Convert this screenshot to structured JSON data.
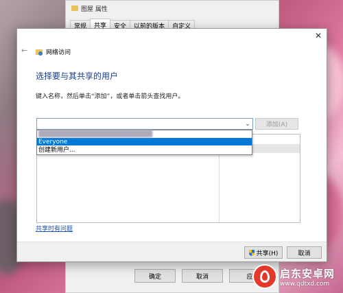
{
  "props_window": {
    "title": "图屋 属性",
    "tabs": [
      "常规",
      "共享",
      "安全",
      "以前的版本",
      "自定义"
    ],
    "buttons": {
      "ok": "确定",
      "cancel": "取消",
      "apply": "应"
    }
  },
  "dialog": {
    "header": "网络访问",
    "heading": "选择要与其共享的用户",
    "instruction": "键入名称，然后单击“添加”，或者单击箭头查找用户。",
    "add_button": "添加(A)",
    "dropdown_items": [
      "Everyone",
      "创建新用户..."
    ],
    "help_link": "共享时有问题",
    "share_button": "共享(H)",
    "cancel_button": "取消"
  },
  "icons": {
    "close": "close-icon",
    "back": "back-arrow-icon",
    "dropdown": "chevron-down-icon",
    "shield": "uac-shield-icon",
    "network": "network-share-icon"
  },
  "watermark": {
    "title": "启东安卓网",
    "url": "www.qdtxd.com"
  },
  "colors": {
    "accent": "#0078d7",
    "heading": "#1a3c8c",
    "link": "#1a55b0"
  }
}
